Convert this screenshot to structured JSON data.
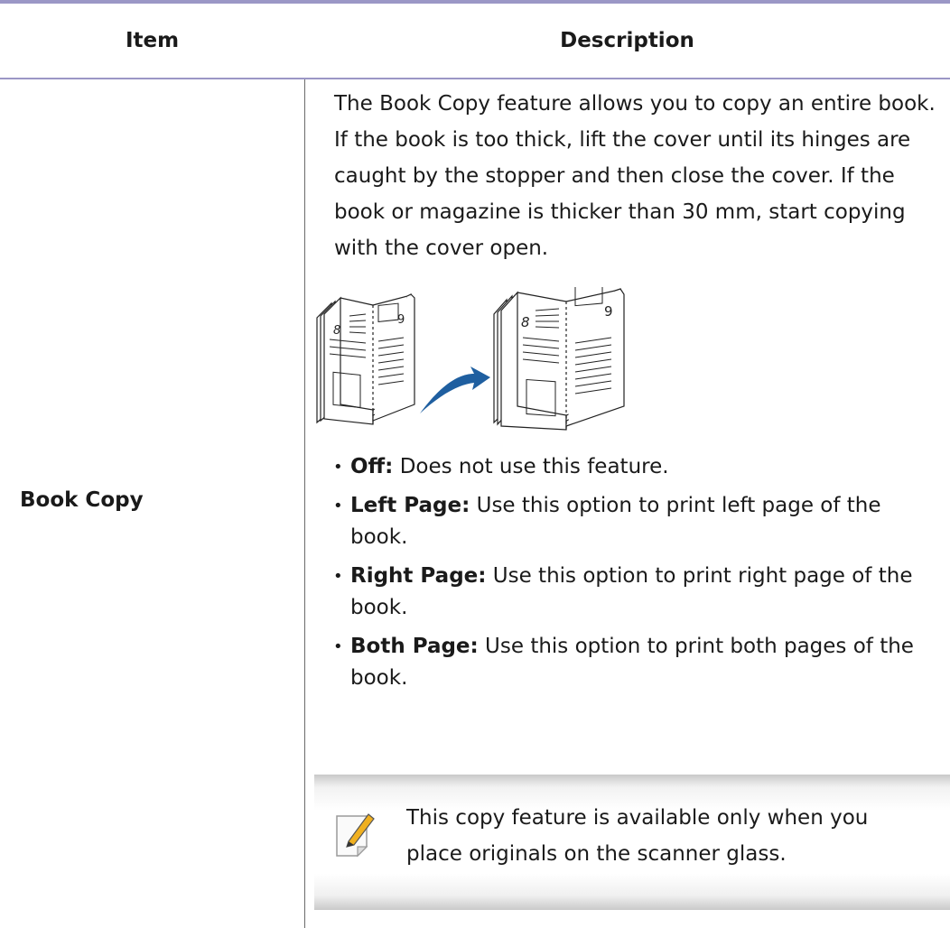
{
  "table": {
    "header": {
      "item": "Item",
      "description": "Description"
    },
    "row": {
      "item": "Book Copy",
      "intro": "The Book Copy feature allows you to copy an entire book. If the book is too thick, lift the cover until its hinges are caught by the stopper and then close the cover. If the book or magazine is thicker than 30 mm, start copying with the cover open.",
      "illustration": {
        "left_book_page_left": "8",
        "left_book_page_right": "9",
        "right_book_page_left": "8",
        "right_book_page_right": "9",
        "arrow_color": "#1f5fa0"
      },
      "options": [
        {
          "term": "Off:",
          "text": " Does not use this feature."
        },
        {
          "term": "Left Page:",
          "text": " Use this option to print left page of the book."
        },
        {
          "term": "Right Page:",
          "text": " Use this option to print right page of the book."
        },
        {
          "term": "Both Page:",
          "text": " Use this option to print both pages of the book."
        }
      ],
      "note": {
        "icon": "note-pencil-icon",
        "text": "This copy feature is available only when you place originals on the scanner glass."
      }
    }
  },
  "colors": {
    "rule": "#9b97c6",
    "divider": "#6b6b6b",
    "note_pencil": "#f0b020"
  }
}
